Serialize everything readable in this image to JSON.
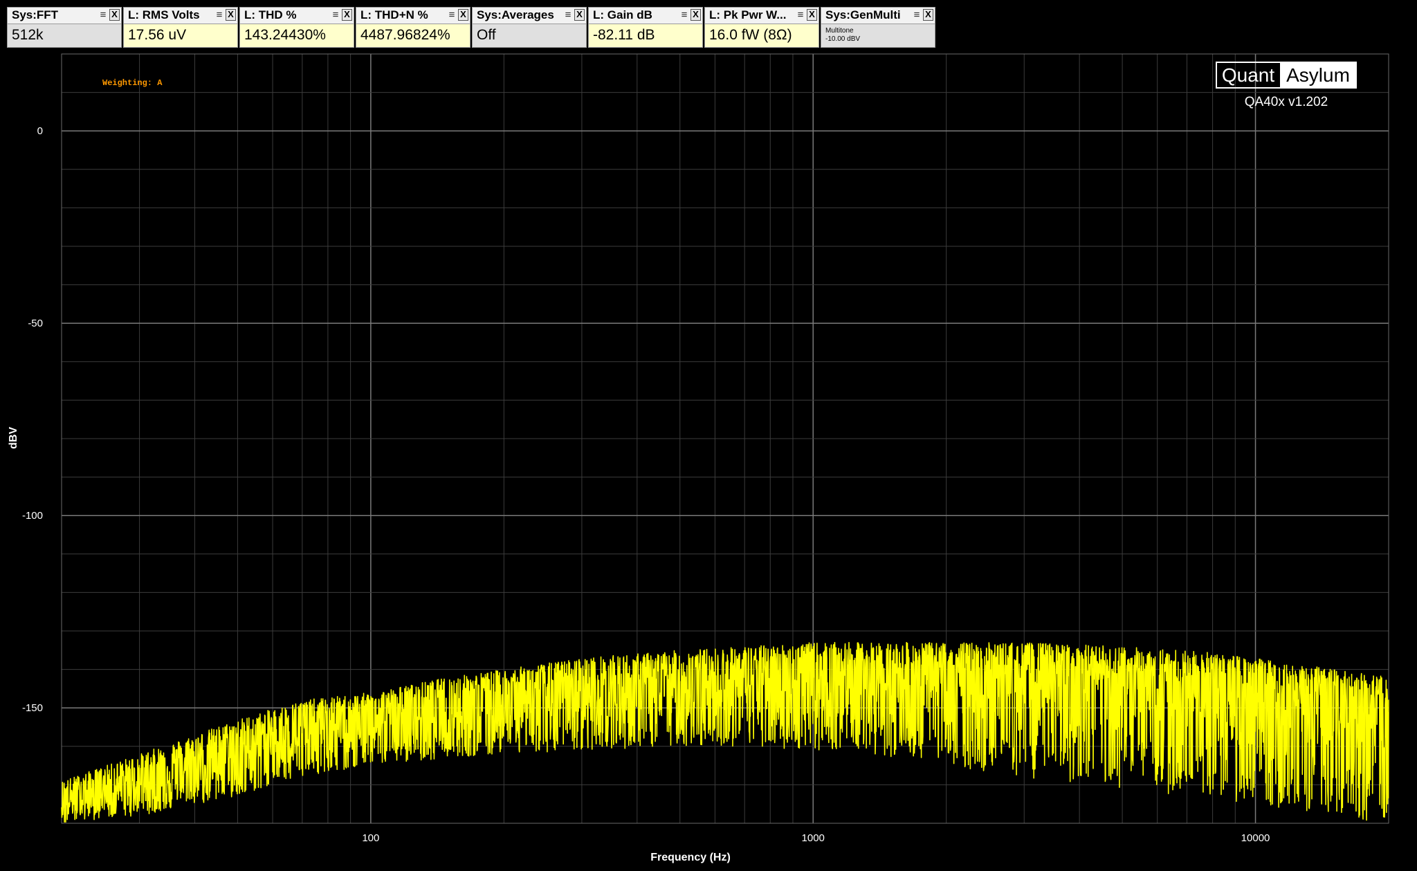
{
  "widgets": [
    {
      "title": "Sys:FFT",
      "value": "512k",
      "style": "gray",
      "width": 166
    },
    {
      "title": "L: RMS Volts",
      "value": "17.56 uV",
      "style": "yellow",
      "width": 166
    },
    {
      "title": "L: THD %",
      "value": "143.24430%",
      "style": "yellow",
      "width": 166
    },
    {
      "title": "L: THD+N %",
      "value": "4487.96824%",
      "style": "yellow",
      "width": 166
    },
    {
      "title": "Sys:Averages",
      "value": "Off",
      "style": "gray",
      "width": 166
    },
    {
      "title": "L: Gain dB",
      "value": "-82.11 dB",
      "style": "yellow",
      "width": 166
    },
    {
      "title": "L: Pk Pwr W...",
      "value": "16.0 fW (8Ω)",
      "style": "yellow",
      "width": 166
    },
    {
      "title": "Sys:GenMulti",
      "value_lines": [
        "Multitone",
        "-10.00 dBV"
      ],
      "style": "small",
      "width": 166
    }
  ],
  "icons": {
    "menu": "menu-lines-icon",
    "close": "close-x-icon"
  },
  "widget_glyphs": {
    "menu": "≡",
    "close": "X"
  },
  "brand": {
    "logo_part1": "Quant",
    "logo_part2": "Asylum",
    "version": "QA40x v1.202"
  },
  "annotation": "Weighting: A",
  "colors": {
    "trace": "#ffff00",
    "annotation": "#ff9900",
    "grid": "#3a3a3a",
    "axis_text": "#ffffff",
    "background": "#000000"
  },
  "chart_data": {
    "type": "line",
    "xlabel": "Frequency (Hz)",
    "ylabel": "dBV",
    "xscale": "log",
    "xlim": [
      20,
      20000
    ],
    "ylim": [
      -180,
      20
    ],
    "xticks": [
      100,
      1000,
      10000
    ],
    "xtick_labels": [
      "100",
      "1000",
      "10000"
    ],
    "yticks": [
      0,
      -50,
      -100,
      -150
    ],
    "ytick_labels": [
      "0",
      "-50",
      "-100",
      "-150"
    ],
    "grid": true,
    "series": [
      {
        "color": "#ffff00",
        "envelope_x": [
          20,
          30,
          50,
          70,
          100,
          150,
          200,
          300,
          500,
          700,
          1000,
          1500,
          2000,
          3000,
          5000,
          7000,
          10000,
          15000,
          20000
        ],
        "peak_y": [
          -169,
          -162,
          -153,
          -148,
          -146,
          -142,
          -140,
          -137,
          -135,
          -134,
          -133,
          -133,
          -133,
          -133,
          -134,
          -135,
          -137,
          -140,
          -142
        ],
        "mean_y": [
          -175,
          -170,
          -162,
          -157,
          -154,
          -151,
          -149,
          -147,
          -145,
          -144,
          -143,
          -143,
          -143,
          -143,
          -144,
          -145,
          -147,
          -150,
          -152
        ],
        "floor_y": [
          -180,
          -178,
          -173,
          -168,
          -165,
          -163,
          -162,
          -161,
          -160,
          -160,
          -161,
          -163,
          -165,
          -168,
          -171,
          -173,
          -175,
          -178,
          -180
        ]
      }
    ]
  }
}
